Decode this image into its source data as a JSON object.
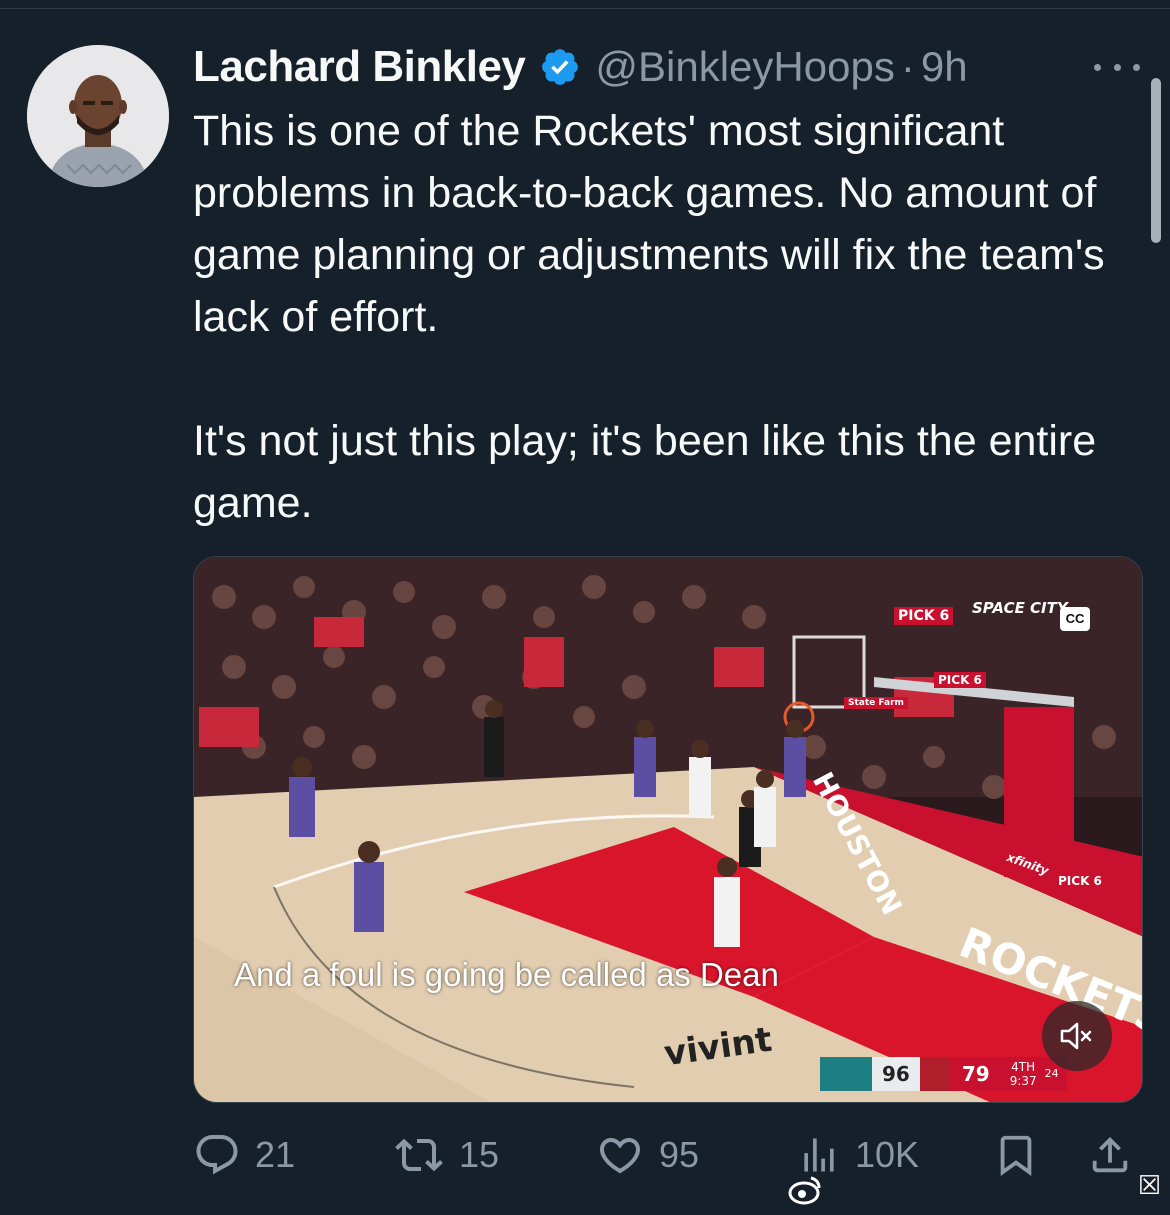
{
  "author": {
    "name": "Lachard Binkley",
    "verified": true,
    "handle": "@BinkleyHoops",
    "separator": "·",
    "time": "9h"
  },
  "tweet": {
    "text": "This is one of the Rockets' most significant problems in back-to-back games. No amount of game planning or adjustments will fix the team's lack of effort.\n\nIt's not just this play; it's been like this the entire game."
  },
  "video": {
    "caption": "And a foul is going be called as Dean",
    "cc_label": "CC",
    "scorebug": {
      "away_score": "96",
      "home_score": "79",
      "period": "4TH",
      "clock": "9:37",
      "shot_clock": "24"
    },
    "court_text": {
      "sponsor": "vivint",
      "baseline": "HOUSTON",
      "sideline": "ROCKETS",
      "ad1": "PICK 6",
      "ad2": "SPACE CITY",
      "ad3": "PICK 6",
      "ad4": "State Farm",
      "ad5": "PICK 6",
      "ad6": "xfinity"
    }
  },
  "actions": {
    "replies": "21",
    "retweets": "15",
    "likes": "95",
    "views": "10K"
  },
  "icons": {
    "verified": "verified-badge-icon",
    "more": "more-horizontal-icon",
    "reply": "reply-icon",
    "retweet": "retweet-icon",
    "like": "heart-icon",
    "views": "bar-chart-icon",
    "bookmark": "bookmark-icon",
    "share": "share-icon"
  },
  "colors": {
    "background": "#15202b",
    "text": "#f7f9f9",
    "secondary": "#8b98a5",
    "verified": "#1d9bf0"
  }
}
